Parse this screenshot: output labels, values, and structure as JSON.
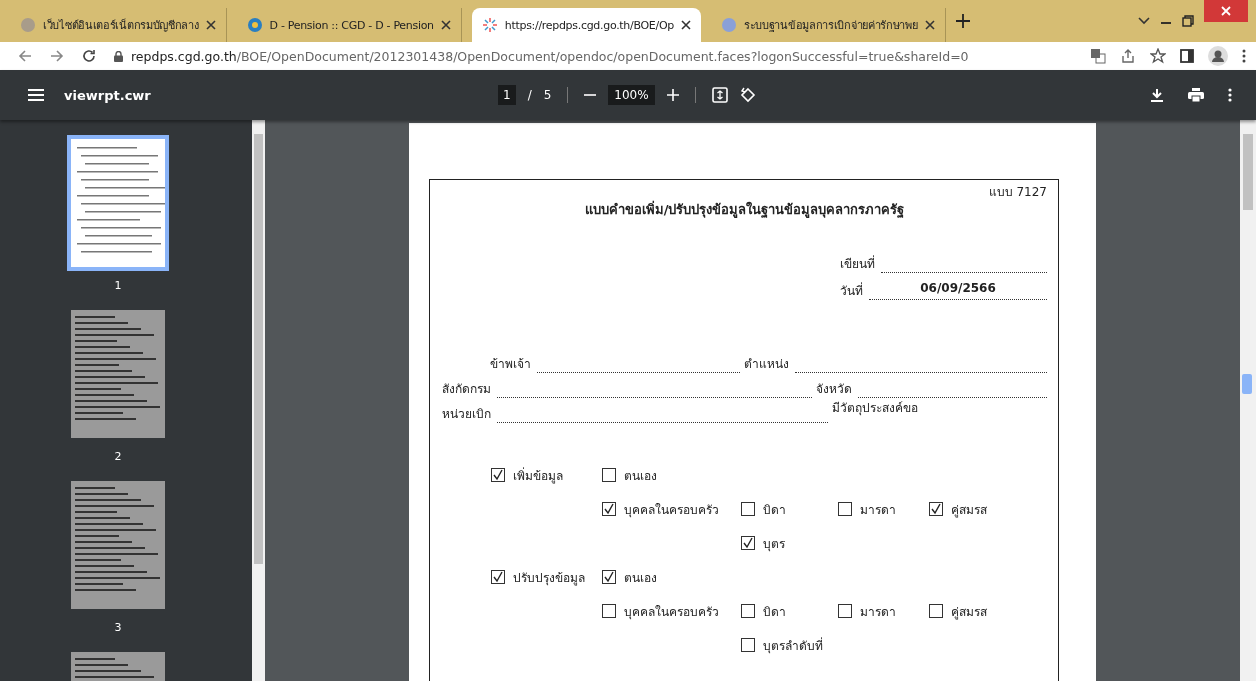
{
  "browser_tabs": [
    {
      "title": "เว็บไซต์อินเตอร์เน็ตกรมบัญชีกลาง",
      "selected": false
    },
    {
      "title": "D - Pension :: CGD - D - Pension",
      "selected": false
    },
    {
      "title": "https://repdps.cgd.go.th/BOE/Op",
      "selected": true
    },
    {
      "title": "ระบบฐานข้อมูลการเบิกจ่ายค่ารักษาพย",
      "selected": false
    }
  ],
  "address_bar": {
    "host": "repdps.cgd.go.th",
    "path": "/BOE/OpenDocument/2012301438/OpenDocument/opendoc/openDocument.faces?logonSuccessful=true&shareId=0"
  },
  "pdf_toolbar": {
    "file_name": "viewrpt.cwr",
    "current_page": "1",
    "page_separator": "/",
    "page_count": "5",
    "zoom": "100%"
  },
  "thumbnails": [
    {
      "label": "1",
      "selected": true
    },
    {
      "label": "2",
      "selected": false
    },
    {
      "label": "3",
      "selected": false
    },
    {
      "selected": false
    }
  ],
  "document": {
    "form_code": "แบบ 7127",
    "title": "แบบคำขอเพิ่ม/ปรับปรุงข้อมูลในฐานข้อมูลบุคลากรภาครัฐ",
    "header_fields": [
      {
        "label": "เขียนที่"
      },
      {
        "label": "วันที่",
        "value": "06/09/2566"
      }
    ],
    "field_rows": [
      [
        {
          "label": "ข้าพเจ้า"
        },
        {
          "label": "ตำแหน่ง"
        }
      ],
      [
        {
          "label": "สังกัดกรม"
        },
        {
          "label": "จังหวัด"
        }
      ],
      [
        {
          "label": "หน่วยเบิก"
        },
        {
          "label": "มีวัตถุประสงค์ขอ",
          "kind": "text"
        }
      ]
    ],
    "request_groups": [
      {
        "label": "เพิ่มข้อมูล",
        "checked": true,
        "options": [
          {
            "label": "ตนเอง",
            "checked": false
          },
          {
            "label": "บุคคลในครอบครัว",
            "checked": true,
            "children": [
              {
                "label": "บิดา",
                "checked": false
              },
              {
                "label": "มารดา",
                "checked": false
              },
              {
                "label": "คู่สมรส",
                "checked": true
              },
              {
                "label": "บุตร",
                "checked": true
              }
            ]
          }
        ]
      },
      {
        "label": "ปรับปรุงข้อมูล",
        "checked": true,
        "options": [
          {
            "label": "ตนเอง",
            "checked": true
          },
          {
            "label": "บุคคลในครอบครัว",
            "checked": false,
            "children": [
              {
                "label": "บิดา",
                "checked": false
              },
              {
                "label": "มารดา",
                "checked": false
              },
              {
                "label": "คู่สมรส",
                "checked": false
              },
              {
                "label": "บุตรลำดับที่",
                "checked": false
              }
            ]
          }
        ]
      }
    ]
  }
}
